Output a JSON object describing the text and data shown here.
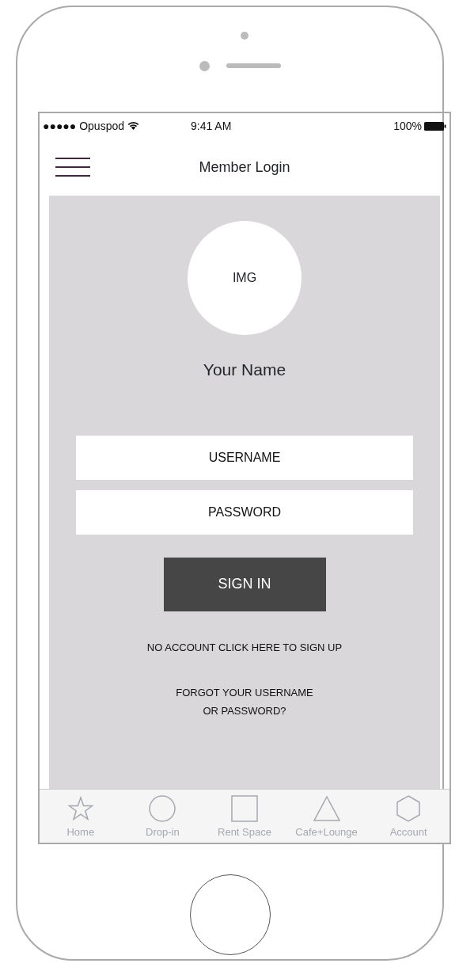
{
  "status_bar": {
    "carrier": "●●●●● Opuspod",
    "time": "9:41 AM",
    "battery": "100%"
  },
  "header": {
    "title": "Member Login"
  },
  "profile": {
    "avatar_text": "IMG",
    "name": "Your Name"
  },
  "form": {
    "username_placeholder": "USERNAME",
    "password_placeholder": "PASSWORD",
    "submit": "SIGN IN"
  },
  "links": [
    {
      "text": "NO ACCOUNT CLICK HERE TO SIGN UP"
    },
    {
      "text": "FORGOT YOUR USERNAME\nOR PASSWORD?"
    }
  ],
  "tabs": [
    {
      "label": "Home",
      "kind": "star"
    },
    {
      "label": "Drop-in",
      "kind": "circle"
    },
    {
      "label": "Rent Space",
      "kind": "square"
    },
    {
      "label": "Cafe+Lounge",
      "kind": "triangle"
    },
    {
      "label": "Account",
      "kind": "hexagon"
    }
  ]
}
